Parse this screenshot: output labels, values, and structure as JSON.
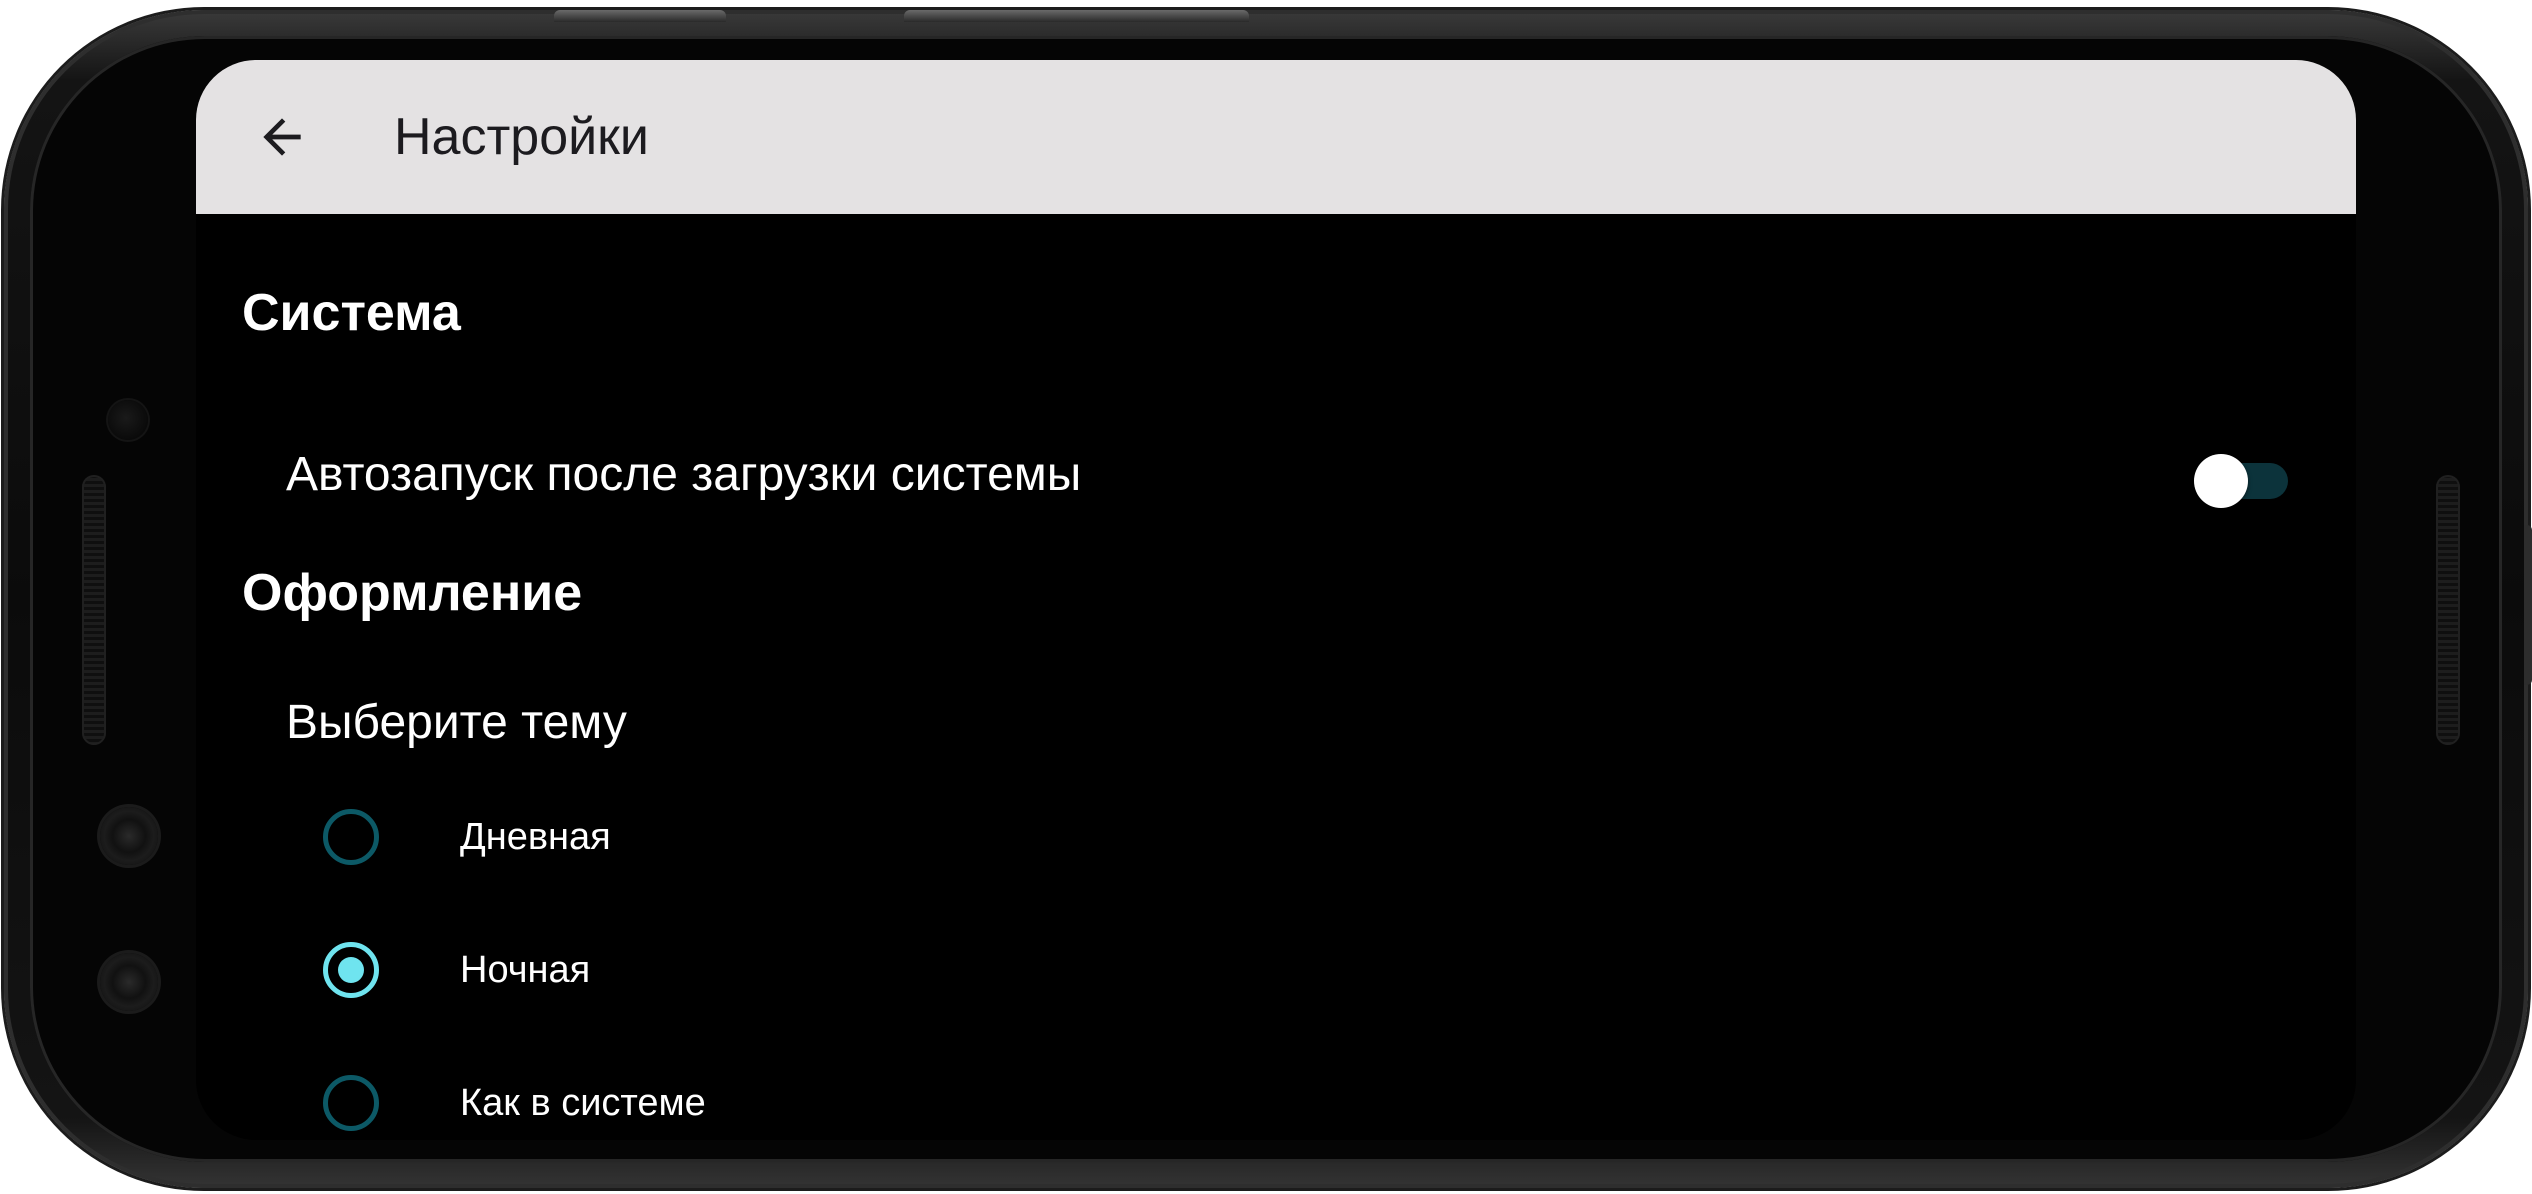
{
  "app_bar": {
    "title": "Настройки",
    "back_icon": "arrow-back-icon"
  },
  "sections": {
    "system": {
      "title": "Система",
      "autostart": {
        "label": "Автозапуск после загрузки системы",
        "enabled": false
      }
    },
    "appearance": {
      "title": "Оформление",
      "theme_prompt": "Выберите тему",
      "options": [
        {
          "label": "Дневная",
          "selected": false
        },
        {
          "label": "Ночная",
          "selected": true
        },
        {
          "label": "Как в системе",
          "selected": false
        }
      ]
    }
  },
  "colors": {
    "app_bar_background": "#e4e2e3",
    "screen_background": "#000000",
    "accent": "#6fe4ef",
    "radio_unselected": "#0c5966",
    "switch_track_off": "#0c333b"
  }
}
